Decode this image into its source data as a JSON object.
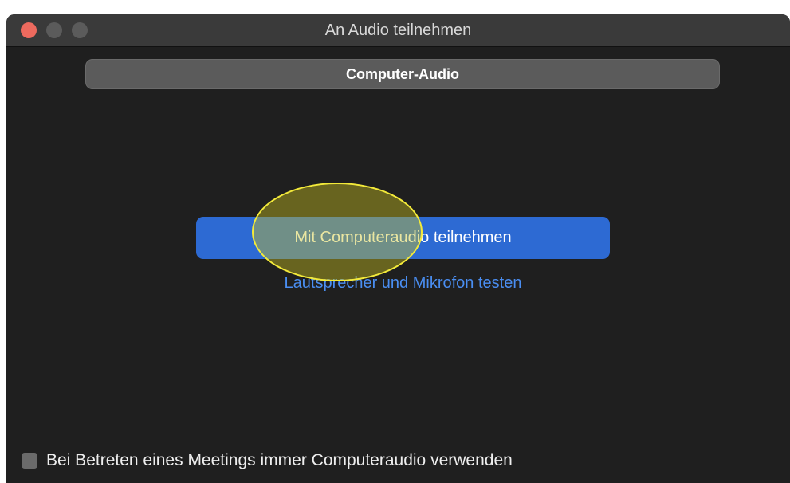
{
  "window": {
    "title": "An Audio teilnehmen"
  },
  "tabs": {
    "active_label": "Computer-Audio"
  },
  "main": {
    "join_button_label": "Mit Computeraudio teilnehmen",
    "test_link_label": "Lautsprecher und Mikrofon testen"
  },
  "footer": {
    "checkbox_label": "Bei Betreten eines Meetings immer Computeraudio verwenden",
    "checkbox_checked": false
  },
  "colors": {
    "background": "#1f1f1f",
    "primary_button": "#2d6ad3",
    "link": "#4a8ef2",
    "close_button": "#ed6a5e",
    "highlight": "#f3ea3a"
  }
}
